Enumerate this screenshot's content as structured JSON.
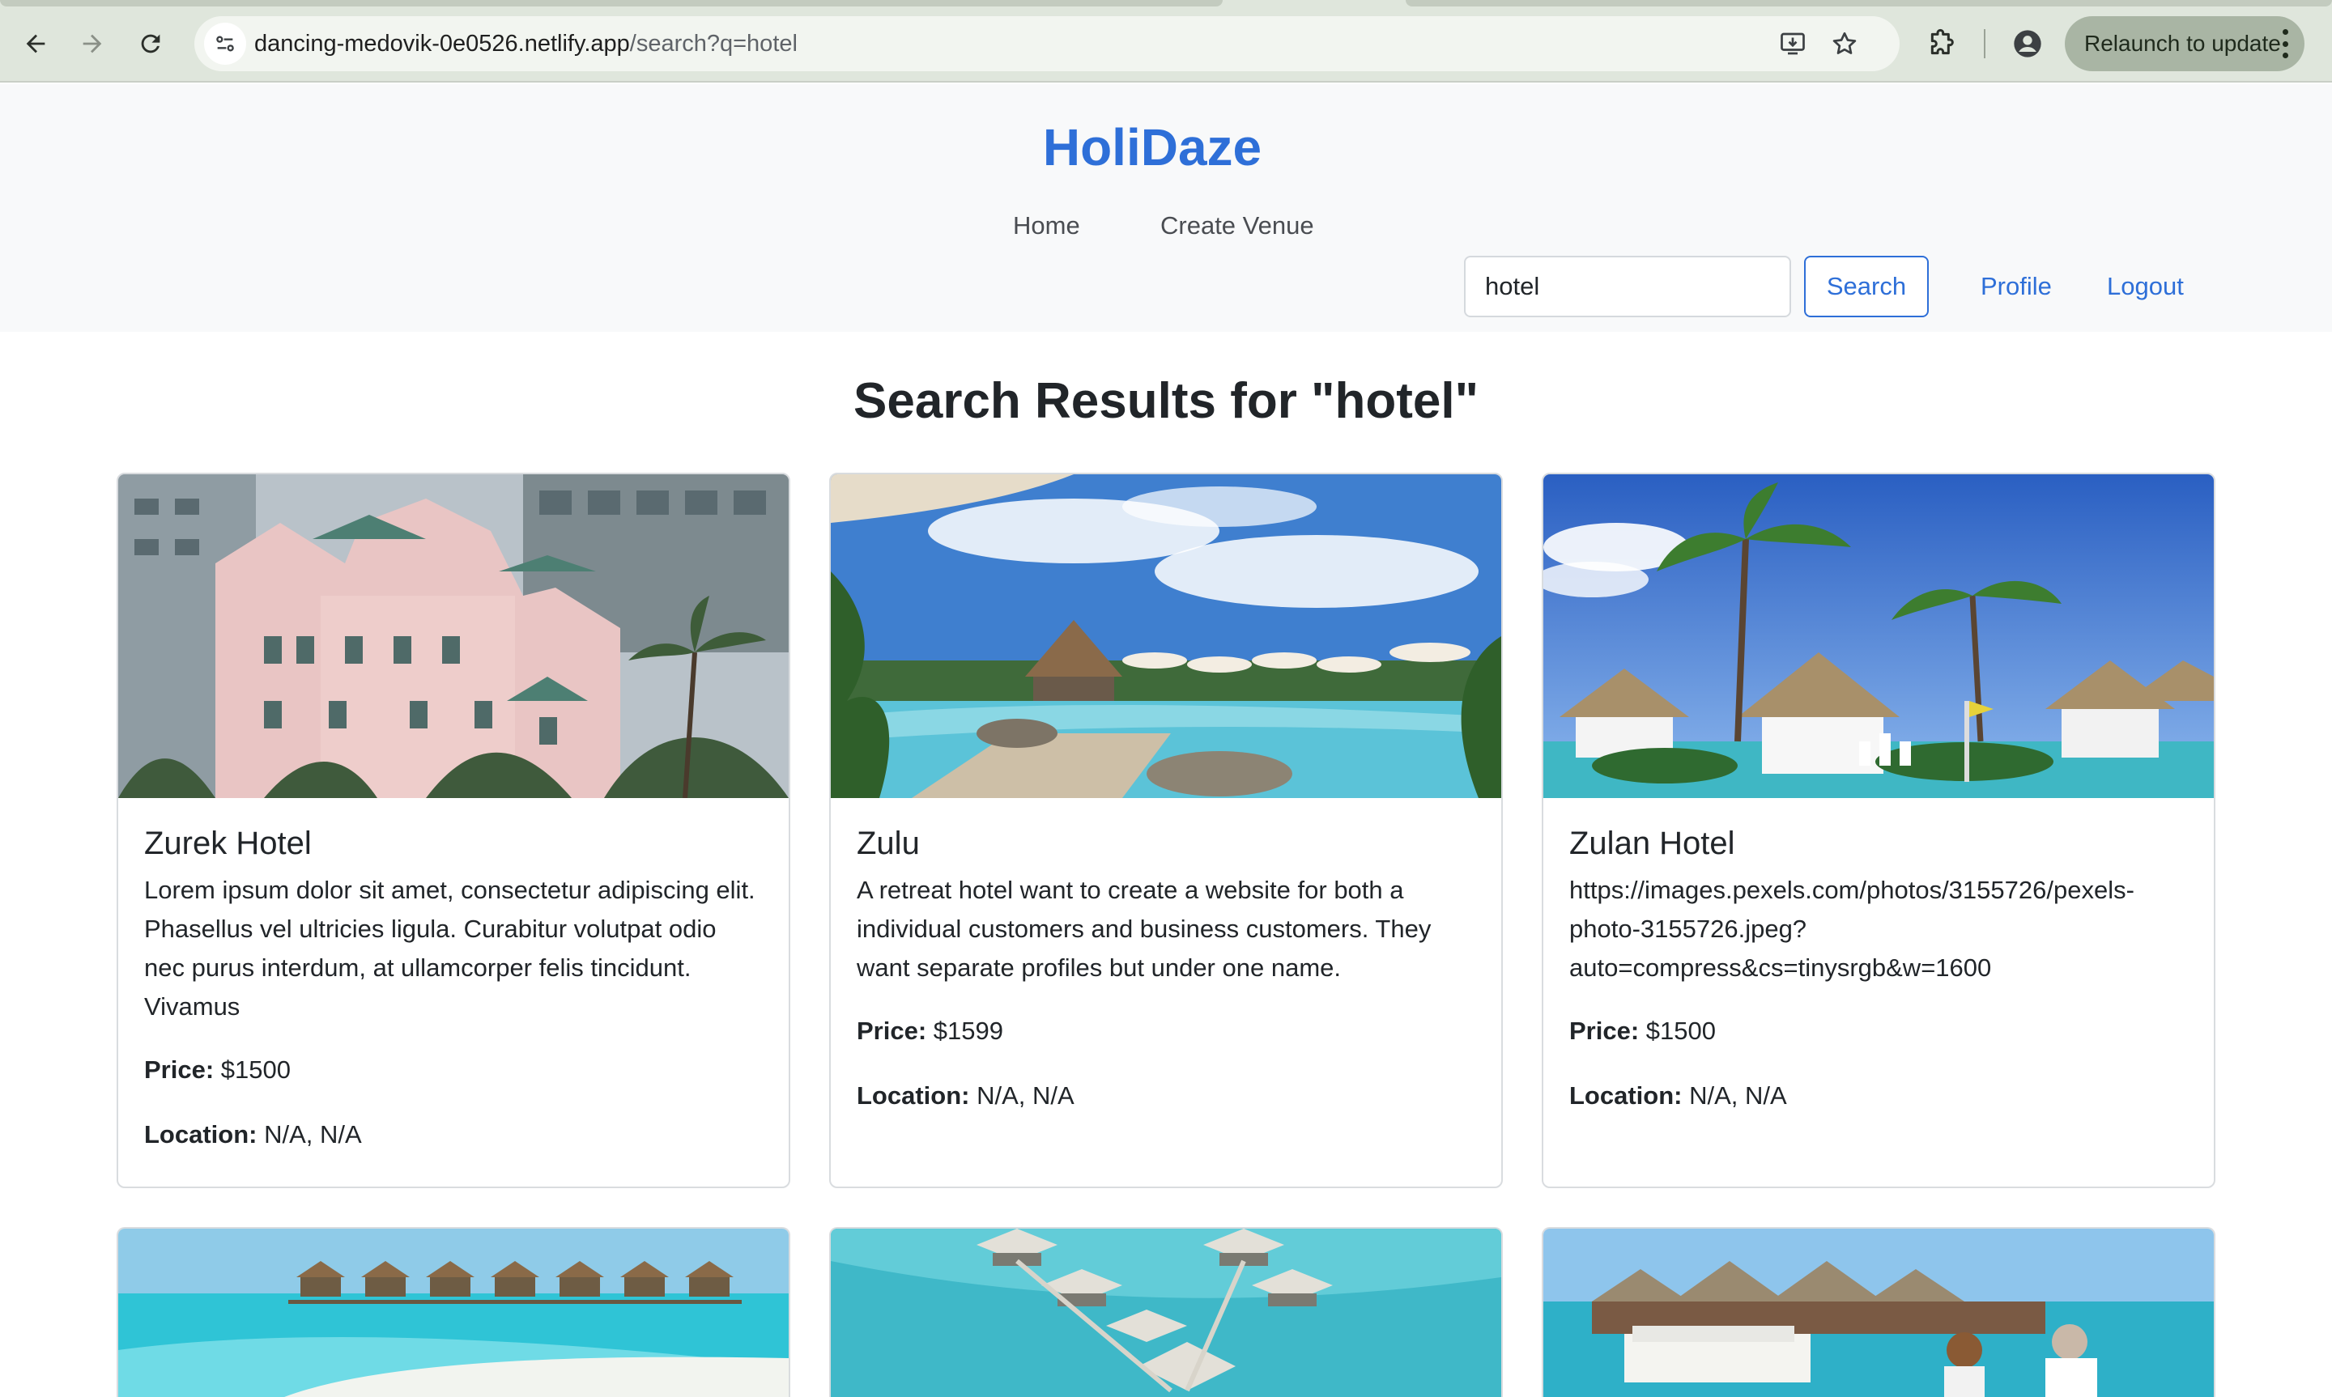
{
  "browser": {
    "url_host": "dancing-medovik-0e0526.netlify.app",
    "url_path": "/search?q=hotel",
    "relaunch_label": "Relaunch to update"
  },
  "site": {
    "brand": "HoliDaze",
    "nav": {
      "home": "Home",
      "create_venue": "Create Venue"
    },
    "search": {
      "value": "hotel",
      "button_label": "Search"
    },
    "user": {
      "profile": "Profile",
      "logout": "Logout"
    }
  },
  "results": {
    "heading": "Search Results for \"hotel\"",
    "price_label": "Price:",
    "location_label": "Location:",
    "venues": [
      {
        "name": "Zurek Hotel",
        "description": "Lorem ipsum dolor sit amet, consectetur adipiscing elit. Phasellus vel ultricies ligula. Curabitur volutpat odio nec purus interdum, at ullamcorper felis tincidunt. Vivamus",
        "price": "$1500",
        "location": "N/A, N/A"
      },
      {
        "name": "Zulu",
        "description": "A retreat hotel want to create a website for both a individual customers and business customers. They want separate profiles but under one name.",
        "price": "$1599",
        "location": "N/A, N/A"
      },
      {
        "name": "Zulan Hotel",
        "description": "https://images.pexels.com/photos/3155726/pexels-photo-3155726.jpeg?auto=compress&cs=tinysrgb&w=1600",
        "price": "$1500",
        "location": "N/A, N/A"
      }
    ]
  },
  "colors": {
    "brand": "#2e6fd8",
    "header_bg": "#f8f9fa",
    "card_border": "#d9dcdf",
    "chrome_bg": "#dfe6dc"
  }
}
